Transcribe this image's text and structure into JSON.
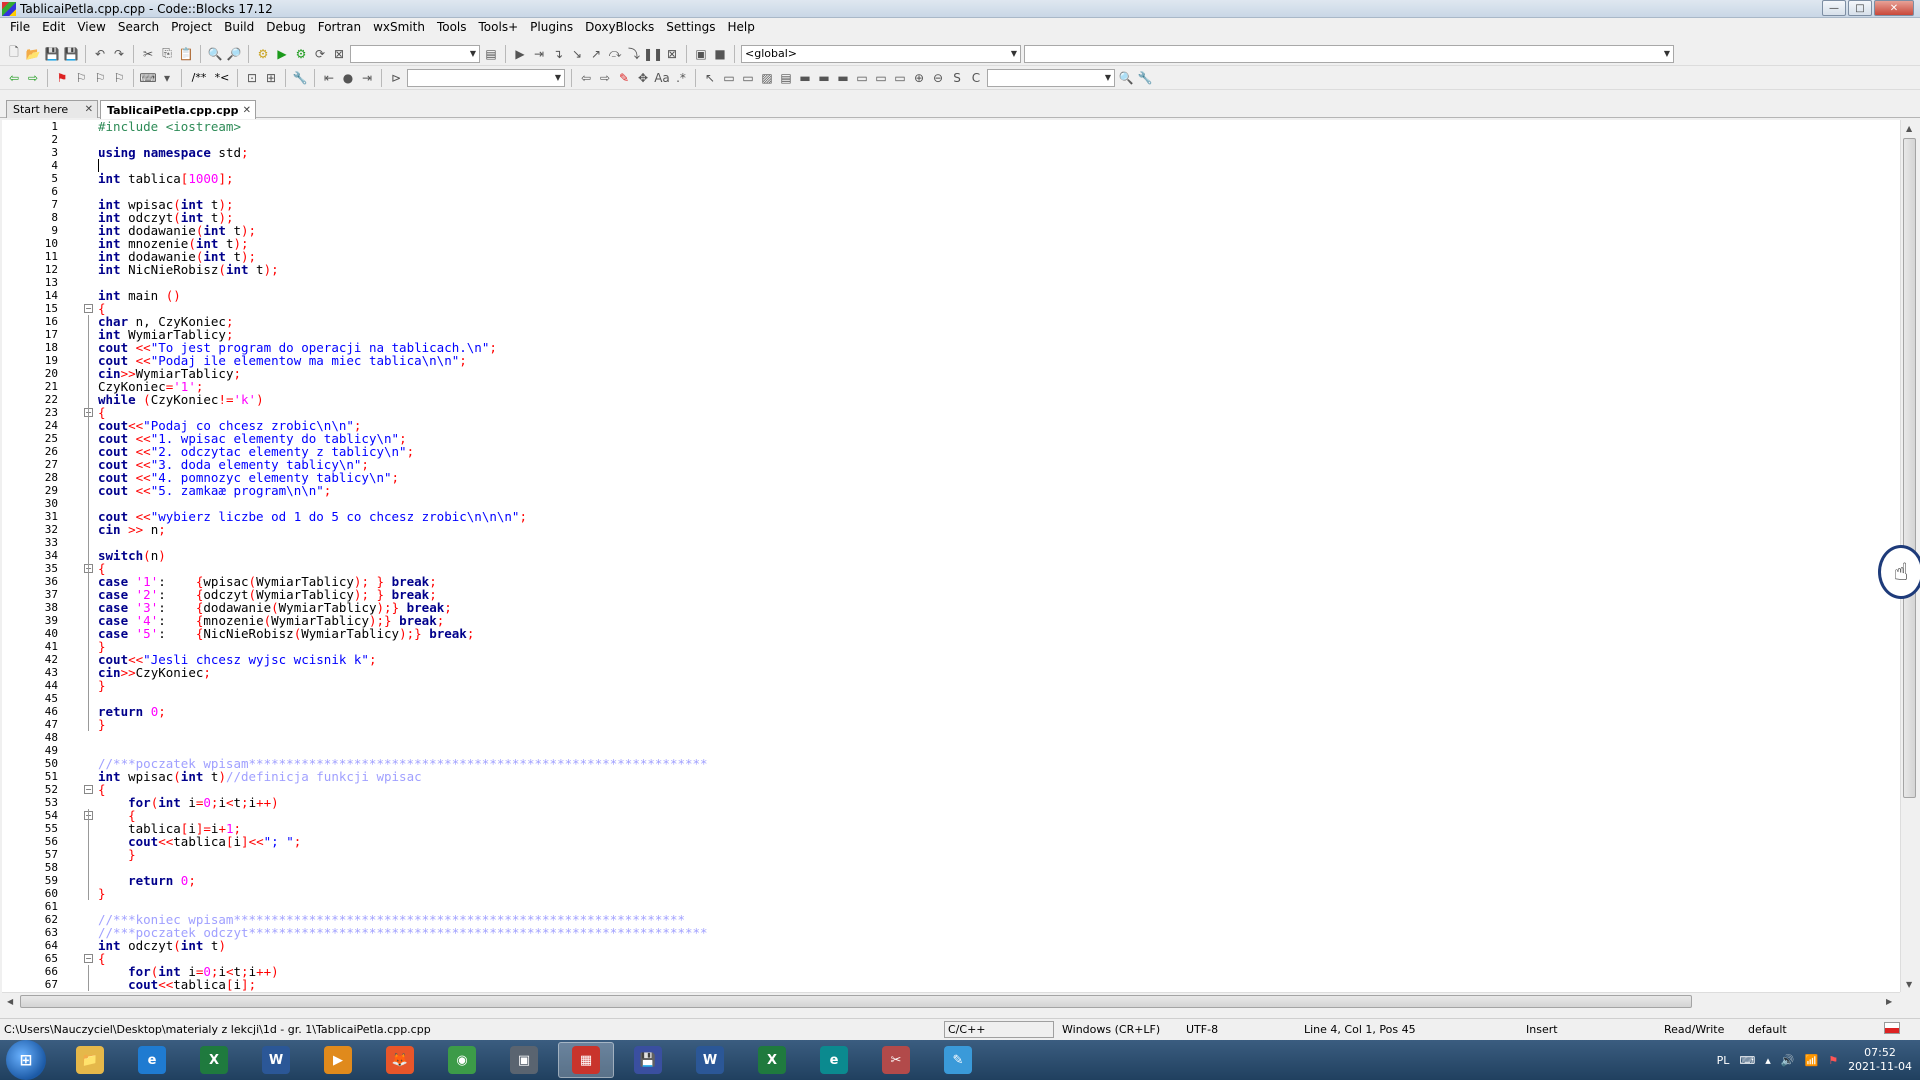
{
  "window": {
    "title": "TablicaiPetla.cpp.cpp - Code::Blocks 17.12",
    "minimize": "—",
    "maximize": "□",
    "close": "✕"
  },
  "menu": [
    "File",
    "Edit",
    "View",
    "Search",
    "Project",
    "Build",
    "Debug",
    "Fortran",
    "wxSmith",
    "Tools",
    "Tools+",
    "Plugins",
    "DoxyBlocks",
    "Settings",
    "Help"
  ],
  "toolbar": {
    "scope_combo": "<global>",
    "symbol_combo": "",
    "build_target": "",
    "search_combo": "",
    "comment_label": "/**",
    "stream_label": "*<"
  },
  "tabs": [
    {
      "label": "Start here",
      "active": false
    },
    {
      "label": "TablicaiPetla.cpp.cpp",
      "active": true
    }
  ],
  "editor": {
    "lines": [
      "#include <iostream>",
      "",
      "using namespace std;",
      "",
      "int tablica[1000];",
      "",
      "int wpisac(int t);",
      "int odczyt(int t);",
      "int dodawanie(int t);",
      "int mnozenie(int t);",
      "int dodawanie(int t);",
      "int NicNieRobisz(int t);",
      "",
      "int main ()",
      "{",
      "char n, CzyKoniec;",
      "int WymiarTablicy;",
      "cout <<\"To jest program do operacji na tablicach.\\n\";",
      "cout <<\"Podaj ile elementow ma miec tablica\\n\\n\";",
      "cin>>WymiarTablicy;",
      "CzyKoniec='1';",
      "while (CzyKoniec!='k')",
      "{",
      "cout<<\"Podaj co chcesz zrobic\\n\\n\";",
      "cout <<\"1. wpisac elementy do tablicy\\n\";",
      "cout <<\"2. odczytac elementy z tablicy\\n\";",
      "cout <<\"3. doda elementy tablicy\\n\";",
      "cout <<\"4. pomnozyc elementy tablicy\\n\";",
      "cout <<\"5. zamkaæ program\\n\\n\";",
      "",
      "cout <<\"wybierz liczbe od 1 do 5 co chcesz zrobic\\n\\n\\n\";",
      "cin >> n;",
      "",
      "switch(n)",
      "{",
      "case '1':    {wpisac(WymiarTablicy); } break;",
      "case '2':    {odczyt(WymiarTablicy); } break;",
      "case '3':    {dodawanie(WymiarTablicy);} break;",
      "case '4':    {mnozenie(WymiarTablicy);} break;",
      "case '5':    {NicNieRobisz(WymiarTablicy);} break;",
      "}",
      "cout<<\"Jesli chcesz wyjsc wcisnik k\";",
      "cin>>CzyKoniec;",
      "}",
      "",
      "return 0;",
      "}",
      "",
      "",
      "//***poczatek wpisam*************************************************************",
      "int wpisac(int t)//definicja funkcji wpisac",
      "{",
      "    for(int i=0;i<t;i++)",
      "    {",
      "    tablica[i]=i+1;",
      "    cout<<tablica[i]<<\"; \";",
      "    }",
      "",
      "    return 0;",
      "}",
      "",
      "//***koniec wpisam************************************************************",
      "//***poczatek odczyt*************************************************************",
      "int odczyt(int t)",
      "{",
      "    for(int i=0;i<t;i++)",
      "    cout<<tablica[i];"
    ]
  },
  "status": {
    "path": "C:\\Users\\Nauczyciel\\Desktop\\materialy z lekcji\\1d - gr. 1\\TablicaiPetla.cpp.cpp",
    "language": "C/C++",
    "eol": "Windows (CR+LF)",
    "encoding": "UTF-8",
    "position": "Line 4, Col 1, Pos 45",
    "mode": "Insert",
    "access": "Read/Write",
    "profile": "default"
  },
  "taskbar": {
    "start": "⊞",
    "apps": [
      {
        "name": "explorer",
        "glyph": "📁",
        "color": "#e5b84a"
      },
      {
        "name": "ie",
        "glyph": "e",
        "color": "#1f7bd1"
      },
      {
        "name": "excel",
        "glyph": "X",
        "color": "#1f7a3e"
      },
      {
        "name": "word",
        "glyph": "W",
        "color": "#2b5797"
      },
      {
        "name": "media",
        "glyph": "▶",
        "color": "#e08a1c"
      },
      {
        "name": "firefox",
        "glyph": "🦊",
        "color": "#e8562a"
      },
      {
        "name": "chrome",
        "glyph": "◉",
        "color": "#3c9b48"
      },
      {
        "name": "tool",
        "glyph": "▣",
        "color": "#5a6470"
      },
      {
        "name": "codeblocks",
        "glyph": "▦",
        "color": "#c9342c"
      },
      {
        "name": "save",
        "glyph": "💾",
        "color": "#3a4fa0"
      },
      {
        "name": "word2",
        "glyph": "W",
        "color": "#2b5797"
      },
      {
        "name": "excel2",
        "glyph": "X",
        "color": "#1f7a3e"
      },
      {
        "name": "edge",
        "glyph": "e",
        "color": "#0b8a8f"
      },
      {
        "name": "snip",
        "glyph": "✂",
        "color": "#b24a4a"
      },
      {
        "name": "notes",
        "glyph": "✎",
        "color": "#3a9ad9"
      }
    ],
    "lang": "PL",
    "time": "07:52",
    "date": "2021-11-04"
  }
}
